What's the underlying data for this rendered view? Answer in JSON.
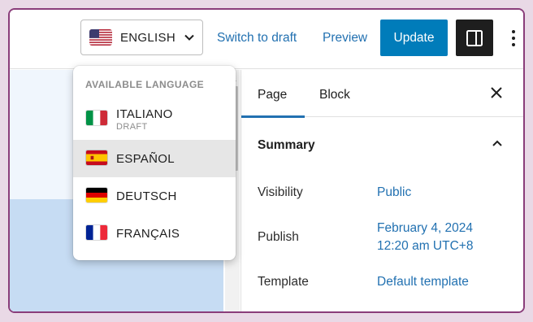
{
  "header": {
    "language_selector": {
      "label": "ENGLISH",
      "flag": "us-flag-icon"
    },
    "switch_to_draft": "Switch to draft",
    "preview": "Preview",
    "update": "Update",
    "colors": {
      "accent": "#007cba",
      "link": "#2271b1"
    }
  },
  "language_menu": {
    "heading": "AVAILABLE LANGUAGE",
    "items": [
      {
        "label": "ITALIANO",
        "sublabel": "DRAFT",
        "flag": "italy-flag-icon"
      },
      {
        "label": "ESPAÑOL",
        "sublabel": "",
        "flag": "spain-flag-icon"
      },
      {
        "label": "DEUTSCH",
        "sublabel": "",
        "flag": "germany-flag-icon"
      },
      {
        "label": "FRANÇAIS",
        "sublabel": "",
        "flag": "france-flag-icon"
      }
    ]
  },
  "sidebar": {
    "tabs": [
      {
        "label": "Page",
        "active": true
      },
      {
        "label": "Block",
        "active": false
      }
    ],
    "summary": {
      "title": "Summary",
      "rows": [
        {
          "label": "Visibility",
          "value": "Public"
        },
        {
          "label": "Publish",
          "value_line1": "February 4, 2024",
          "value_line2": "12:20 am UTC+8"
        },
        {
          "label": "Template",
          "value": "Default template"
        }
      ]
    }
  }
}
